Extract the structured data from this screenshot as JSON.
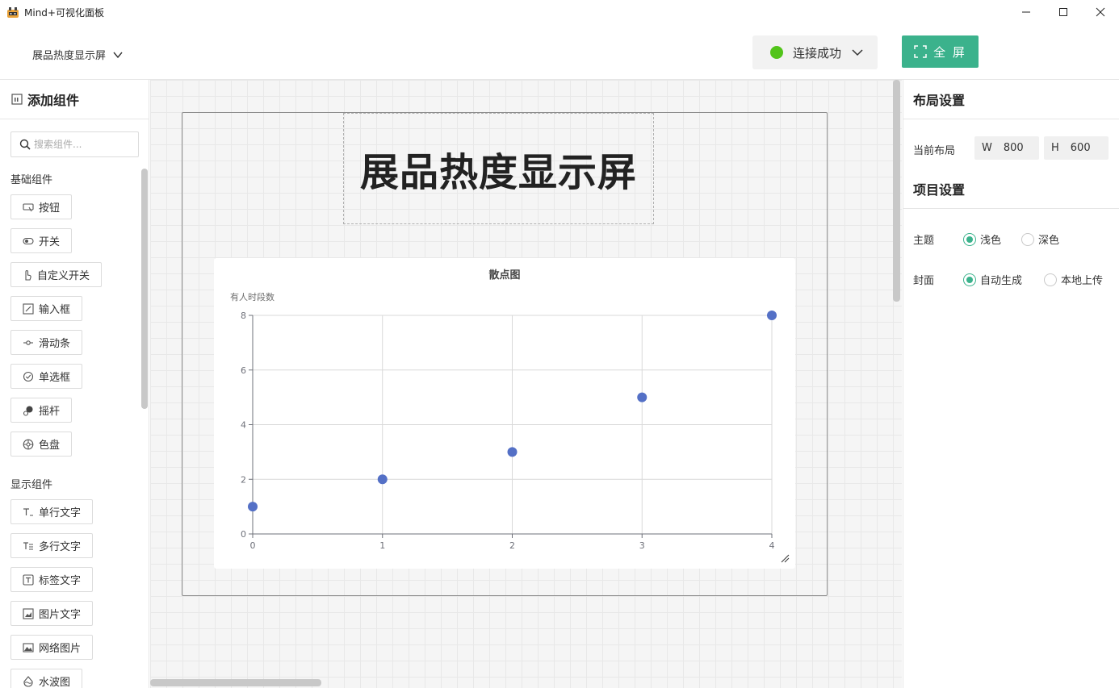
{
  "window": {
    "title": "Mind+可视化面板"
  },
  "header": {
    "screen_name": "展品热度显示屏",
    "connection_status": "连接成功",
    "fullscreen_label": "全 屏"
  },
  "sidebar": {
    "title": "添加组件",
    "search_placeholder": "搜索组件...",
    "basic_group": "基础组件",
    "basic_items": [
      "按钮",
      "开关",
      "自定义开关",
      "输入框",
      "滑动条",
      "单选框",
      "摇杆",
      "色盘"
    ],
    "display_group": "显示组件",
    "display_items": [
      "单行文字",
      "多行文字",
      "标签文字",
      "图片文字",
      "网络图片",
      "水波图"
    ]
  },
  "canvas": {
    "title_text": "展品热度显示屏"
  },
  "chart_data": {
    "type": "scatter",
    "title": "散点图",
    "ylabel": "有人时段数",
    "xlabel": "",
    "x": [
      0,
      1,
      2,
      3,
      4
    ],
    "y": [
      1,
      2,
      3,
      5,
      8
    ],
    "xlim": [
      0,
      4
    ],
    "ylim": [
      0,
      8
    ],
    "xticks": [
      0,
      1,
      2,
      3,
      4
    ],
    "yticks": [
      0,
      2,
      4,
      6,
      8
    ],
    "grid": true,
    "point_color": "#5470c6"
  },
  "right_panel": {
    "layout_title": "布局设置",
    "current_layout_label": "当前布局",
    "width_label": "W",
    "width_value": "800",
    "height_label": "H",
    "height_value": "600",
    "project_title": "项目设置",
    "theme_label": "主题",
    "theme_options": [
      "浅色",
      "深色"
    ],
    "theme_selected": "浅色",
    "cover_label": "封面",
    "cover_options": [
      "自动生成",
      "本地上传"
    ],
    "cover_selected": "自动生成"
  },
  "colors": {
    "accent": "#3bb28c",
    "connected": "#52c41a"
  }
}
